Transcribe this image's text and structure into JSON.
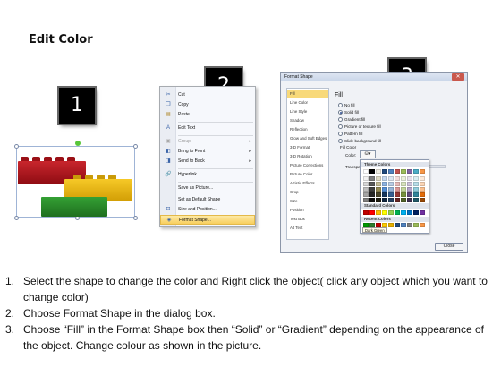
{
  "title": "Edit Color",
  "badges": [
    "1",
    "2",
    "3"
  ],
  "context_menu": {
    "items": [
      {
        "icon": "scissors-icon",
        "label": "Cut",
        "disabled": false,
        "submenu": false
      },
      {
        "icon": "copy-icon",
        "label": "Copy",
        "disabled": false,
        "submenu": false
      },
      {
        "icon": "paste-icon",
        "label": "Paste",
        "disabled": false,
        "submenu": false
      },
      {
        "icon": "edit-text-icon",
        "label": "Edit Text",
        "disabled": false,
        "submenu": false
      },
      {
        "icon": "group-icon",
        "label": "Group",
        "disabled": true,
        "submenu": true
      },
      {
        "icon": "bring-front-icon",
        "label": "Bring to Front",
        "disabled": false,
        "submenu": true
      },
      {
        "icon": "send-back-icon",
        "label": "Send to Back",
        "disabled": false,
        "submenu": true
      },
      {
        "icon": "hyperlink-icon",
        "label": "Hyperlink...",
        "disabled": false,
        "submenu": false
      },
      {
        "icon": "",
        "label": "Save as Picture...",
        "disabled": false,
        "submenu": false
      },
      {
        "icon": "",
        "label": "Set as Default Shape",
        "disabled": false,
        "submenu": false
      },
      {
        "icon": "size-position-icon",
        "label": "Size and Position...",
        "disabled": false,
        "submenu": false
      },
      {
        "icon": "format-shape-icon",
        "label": "Format Shape...",
        "disabled": false,
        "submenu": false,
        "highlighted": true
      }
    ]
  },
  "dialog": {
    "title": "Format Shape",
    "close": "✕",
    "nav": [
      "Fill",
      "Line Color",
      "Line Style",
      "Shadow",
      "Reflection",
      "Glow and Soft Edges",
      "3-D Format",
      "3-D Rotation",
      "Picture Corrections",
      "Picture Color",
      "Artistic Effects",
      "Crop",
      "Size",
      "Position",
      "Text Box",
      "Alt Text"
    ],
    "selected_nav": "Fill",
    "heading": "Fill",
    "fill_options": [
      {
        "label": "No fill",
        "selected": false
      },
      {
        "label": "Solid fill",
        "selected": true
      },
      {
        "label": "Gradient fill",
        "selected": false
      },
      {
        "label": "Picture or texture fill",
        "selected": false
      },
      {
        "label": "Pattern fill",
        "selected": false
      },
      {
        "label": "Slide background fill",
        "selected": false
      }
    ],
    "fill_color_label": "Fill Color",
    "color_label": "Color:",
    "transparency_label": "Transpa",
    "close_button": "Close",
    "palette": {
      "theme_label": "Theme Colors",
      "theme_top": [
        "#ffffff",
        "#000000",
        "#eeece1",
        "#1f497d",
        "#4f81bd",
        "#c0504d",
        "#9bbb59",
        "#8064a2",
        "#4bacc6",
        "#f79646"
      ],
      "theme_shades": [
        [
          "#f2f2f2",
          "#7f7f7f",
          "#ddd9c3",
          "#c6d9f0",
          "#dbe5f1",
          "#f2dcdb",
          "#ebf1dd",
          "#e5e0ec",
          "#dbeef3",
          "#fdeada"
        ],
        [
          "#d8d8d8",
          "#595959",
          "#c4bd97",
          "#8db3e2",
          "#b8cce4",
          "#e5b9b7",
          "#d7e3bc",
          "#ccc1d9",
          "#b7dde8",
          "#fbd5b5"
        ],
        [
          "#bfbfbf",
          "#3f3f3f",
          "#938953",
          "#548dd4",
          "#95b3d7",
          "#d99694",
          "#c3d69b",
          "#b2a2c7",
          "#92cddc",
          "#fac08f"
        ],
        [
          "#a5a5a5",
          "#262626",
          "#494429",
          "#17365d",
          "#366092",
          "#953734",
          "#76923c",
          "#5f497a",
          "#31859b",
          "#e36c09"
        ],
        [
          "#7f7f7f",
          "#0c0c0c",
          "#1d1b10",
          "#0f243e",
          "#244061",
          "#632423",
          "#4f6128",
          "#3f3151",
          "#205867",
          "#974806"
        ]
      ],
      "standard_label": "Standard Colors",
      "standard": [
        "#c00000",
        "#ff0000",
        "#ffc000",
        "#ffff00",
        "#92d050",
        "#00b050",
        "#00b0f0",
        "#0070c0",
        "#002060",
        "#7030a0"
      ],
      "recent_label": "Recent Colors",
      "recent": [
        "#009900",
        "#2c7d2c",
        "#c00000",
        "#ffcc00",
        "#e6b000",
        "#1f497d",
        "#4f81bd",
        "#7f7f7f",
        "#9bbb59",
        "#f79646"
      ],
      "more": "More Colors...",
      "tooltip": "Dark Green"
    }
  },
  "steps": [
    "Select the shape to change the color and Right click the object( click any object which you want to change color)",
    "Choose Format Shape in the dialog box.",
    "Choose “Fill” in the Format Shape box then “Solid” or “Gradient” depending on the appearance of the object. Change colour as shown in the picture."
  ],
  "lego_colors": {
    "red": "#b3131b",
    "yellow": "#e8b60e",
    "green": "#2a8a2a"
  }
}
